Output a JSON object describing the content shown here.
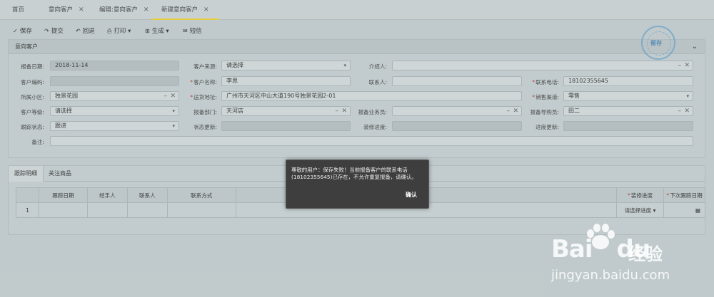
{
  "tabs": [
    {
      "label": "首页",
      "closable": false
    },
    {
      "label": "意向客户",
      "closable": true
    },
    {
      "label": "编辑:意向客户",
      "closable": true
    },
    {
      "label": "新建意向客户",
      "closable": true,
      "active": true
    }
  ],
  "toolbar": {
    "save": "保存",
    "submit": "提交",
    "rollback": "回退",
    "print": "打印",
    "generate": "生成",
    "sms": "短信"
  },
  "panel": {
    "title": "意向客户",
    "fields": {
      "report_date": {
        "label": "报备日期:",
        "value": "2018-11-14"
      },
      "customer_source": {
        "label": "客户来源:",
        "value": "请选择"
      },
      "referrer": {
        "label": "介绍人:",
        "value": ""
      },
      "customer_code": {
        "label": "客户编码:",
        "value": ""
      },
      "customer_name": {
        "label": "客户名称:",
        "value": "李思"
      },
      "contact_person": {
        "label": "联系人:",
        "value": ""
      },
      "contact_phone": {
        "label": "联系电话:",
        "value": "18102355645"
      },
      "community": {
        "label": "所属小区:",
        "value": "独景花园"
      },
      "delivery_address": {
        "label": "送货地址:",
        "value": "广州市天河区中山大道190号独景花园2-01"
      },
      "sales_channel": {
        "label": "销售渠道:",
        "value": "零售"
      },
      "customer_level": {
        "label": "客户等级:",
        "value": "请选择"
      },
      "report_dept": {
        "label": "报备部门:",
        "value": "天河店"
      },
      "report_salesman": {
        "label": "报备业务员:",
        "value": ""
      },
      "report_guide": {
        "label": "报备导购员:",
        "value": "田二"
      },
      "follow_status": {
        "label": "跟踪状态:",
        "value": "跟进"
      },
      "status_update": {
        "label": "状态更新:",
        "value": ""
      },
      "decoration_progress": {
        "label": "装修进度:",
        "value": ""
      },
      "progress_update": {
        "label": "进度更新:",
        "value": ""
      },
      "remark": {
        "label": "备注:",
        "value": ""
      }
    }
  },
  "subtabs": [
    "跟踪明细",
    "关注商品"
  ],
  "grid": {
    "headers": [
      "跟踪日期",
      "经手人",
      "联系人",
      "联系方式",
      "装修进度",
      "下次跟踪日期"
    ],
    "rows": [
      {
        "index": "1",
        "progress": "请选择进度"
      }
    ]
  },
  "dialog": {
    "message": "尊敬的用户：保存失败！当前报备客户的联系电话(18102355645)已存在，不允许重复报备，请确认。",
    "ok": "确认"
  },
  "stamp": {
    "label": "留存"
  },
  "watermark": {
    "brand": "Bai",
    "brand2": "du",
    "sub": "经验",
    "url": "jingyan.baidu.com"
  }
}
